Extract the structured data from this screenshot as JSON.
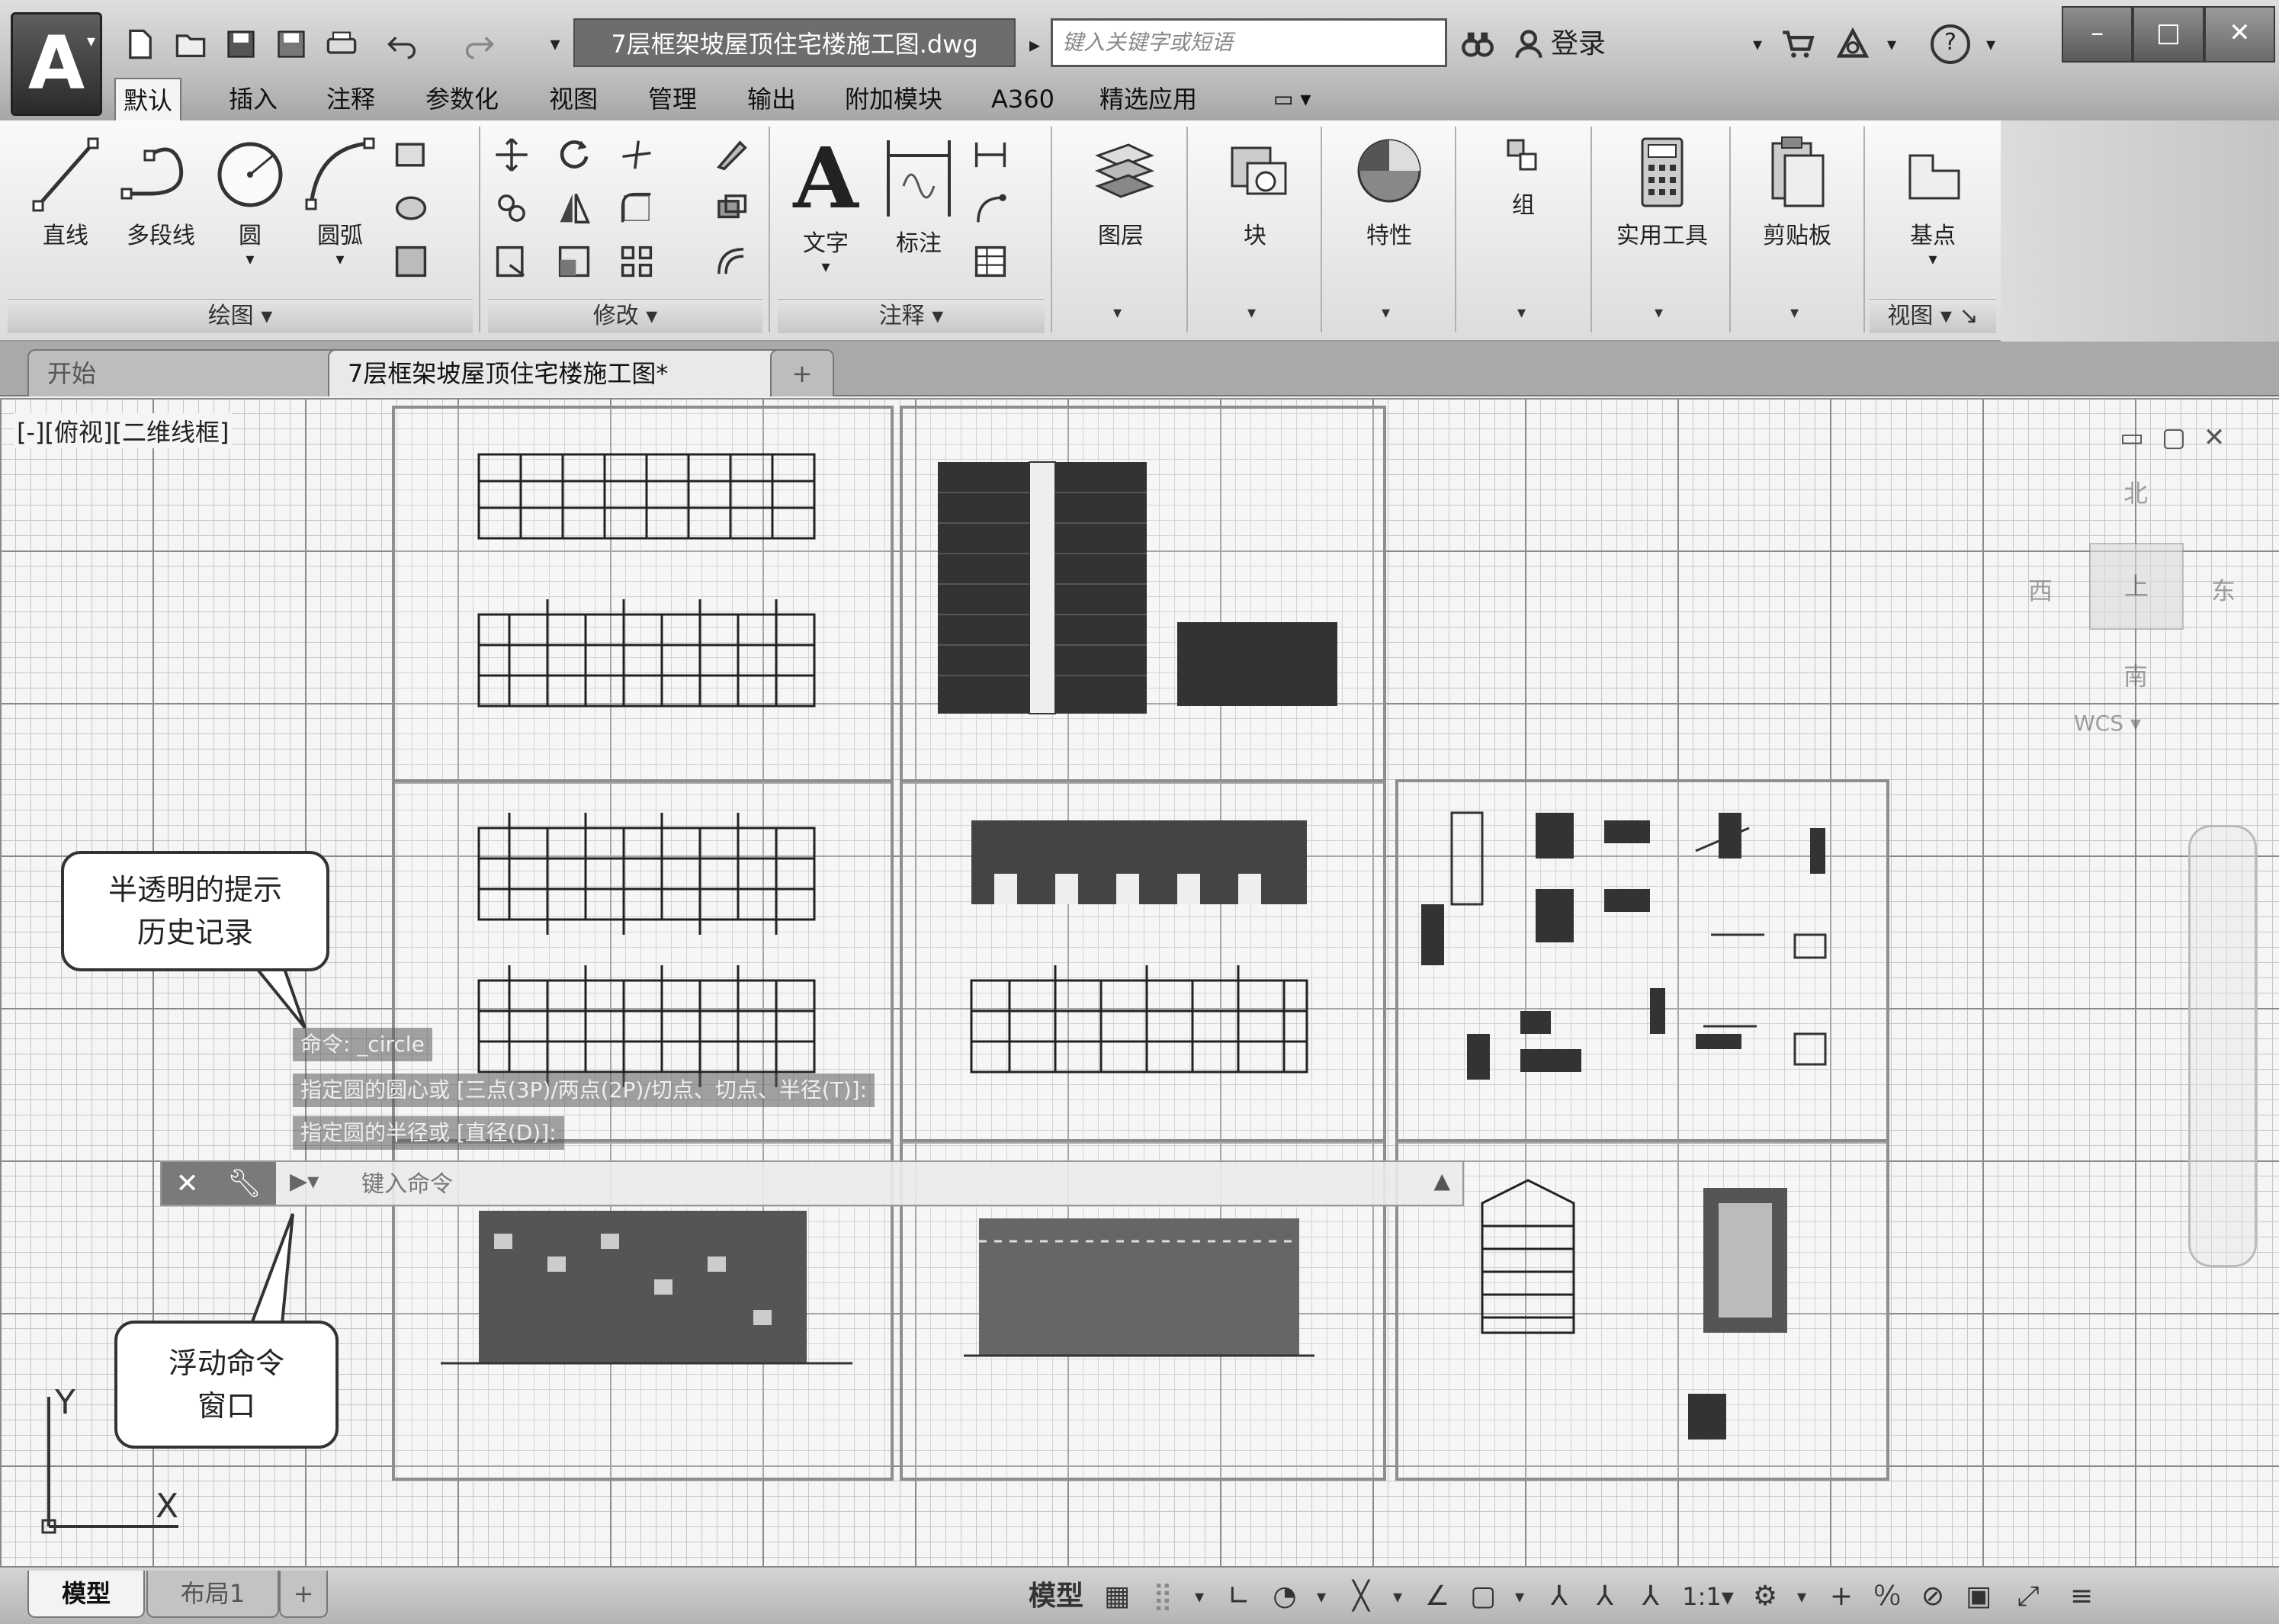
{
  "titlebar": {
    "app_letter": "A",
    "document_title": "7层框架坡屋顶住宅楼施工图.dwg",
    "search_placeholder": "键入关键字或短语",
    "login_label": "登录",
    "help_label": "?"
  },
  "ribbon_tabs": [
    "默认",
    "插入",
    "注释",
    "参数化",
    "视图",
    "管理",
    "输出",
    "附加模块",
    "A360",
    "精选应用"
  ],
  "ribbon": {
    "draw": {
      "line": "直线",
      "polyline": "多段线",
      "circle": "圆",
      "arc": "圆弧",
      "group_label": "绘图"
    },
    "modify": {
      "group_label": "修改"
    },
    "annotation": {
      "text": "文字",
      "dimension": "标注",
      "group_label": "注释"
    },
    "layers": "图层",
    "block": "块",
    "properties": "特性",
    "group": "组",
    "utilities": "实用工具",
    "clipboard": "剪贴板",
    "basepoint": "基点",
    "view_group_label": "视图"
  },
  "file_tabs": {
    "start": "开始",
    "drawing": "7层框架坡屋顶住宅楼施工图*"
  },
  "canvas": {
    "viewport_label": "[-][俯视][二维线框]",
    "viewcube": {
      "top_face": "上",
      "north": "北",
      "south": "南",
      "west": "西",
      "east": "东",
      "wcs": "WCS"
    },
    "callout_history": [
      "半透明的提示",
      "历史记录"
    ],
    "callout_cmd": [
      "浮动命令",
      "窗口"
    ],
    "history_lines": [
      "命令: _circle",
      "指定圆的圆心或 [三点(3P)/两点(2P)/切点、切点、半径(T)]:",
      "指定圆的半径或 [直径(D)]:"
    ],
    "command_placeholder": "键入命令",
    "ucs": {
      "x": "X",
      "y": "Y"
    }
  },
  "statusbar": {
    "tabs": [
      "模型",
      "布局1"
    ],
    "model_label": "模型",
    "scale": "1:1"
  }
}
